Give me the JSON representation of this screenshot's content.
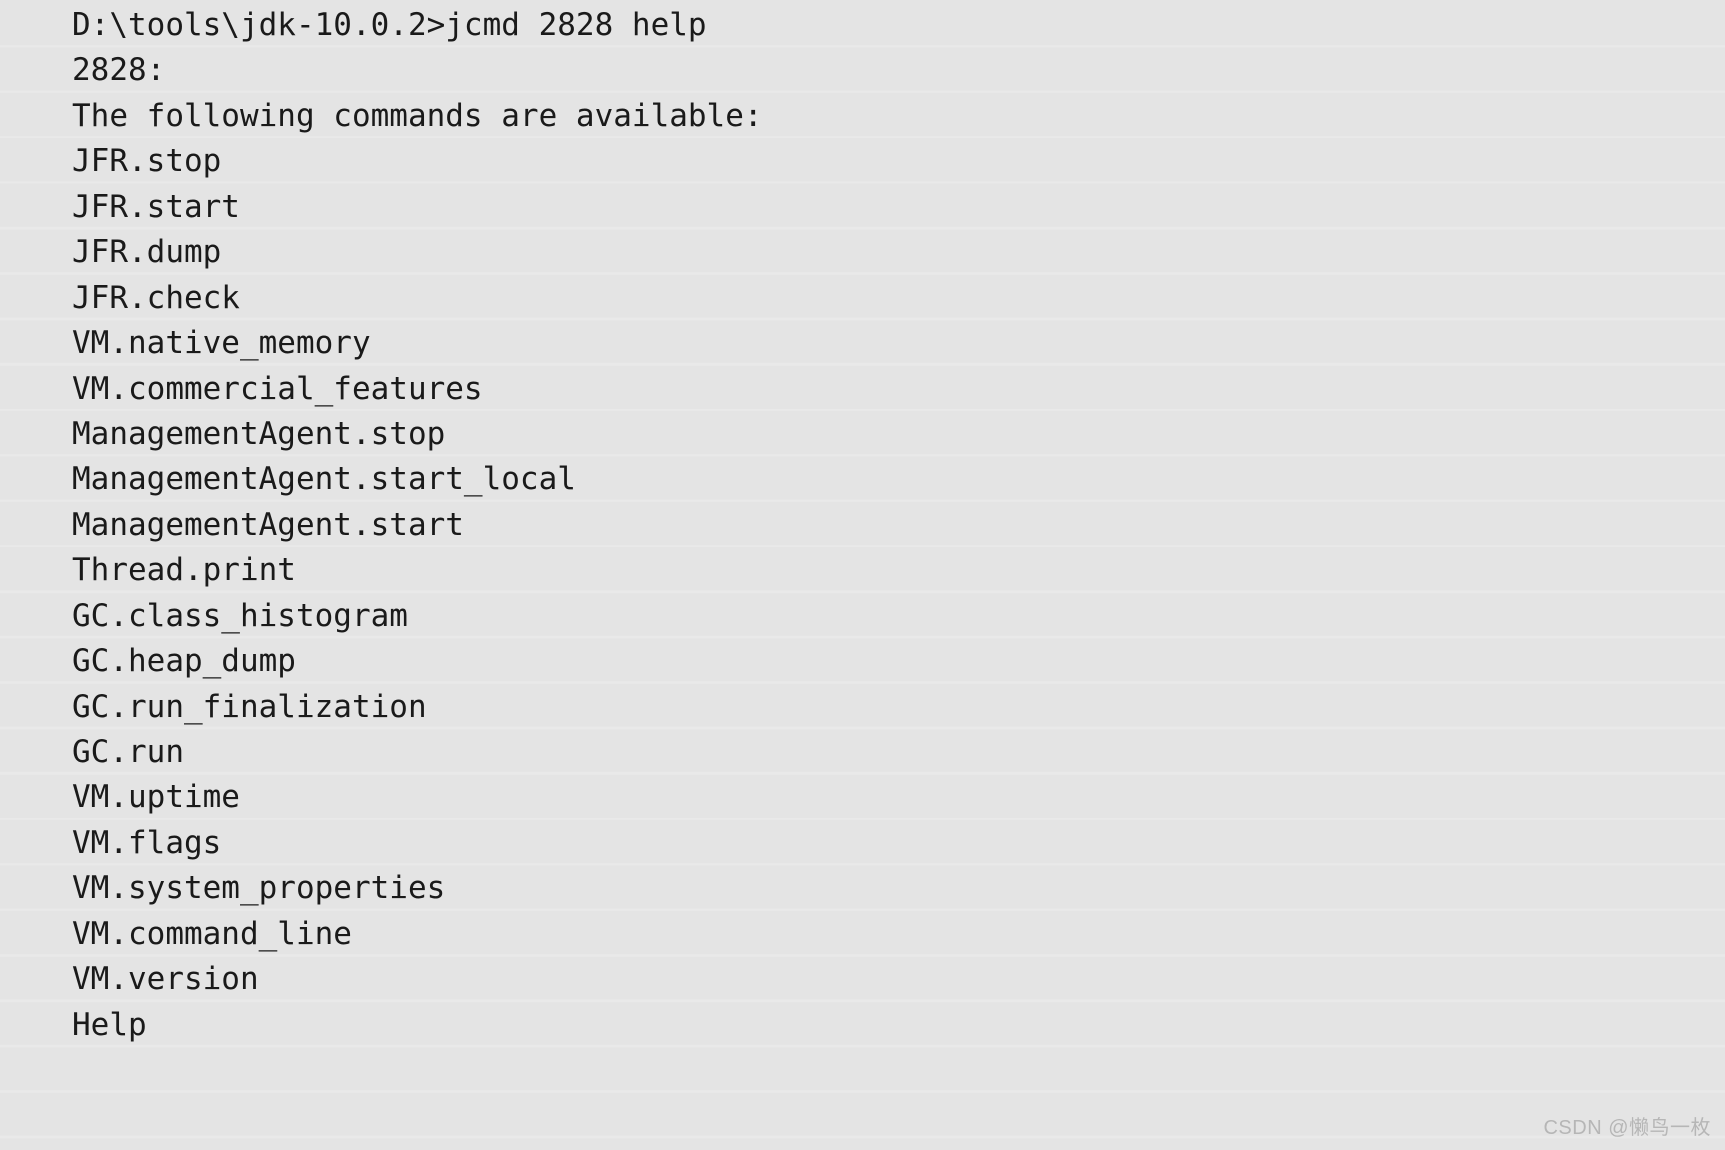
{
  "terminal": {
    "colors": {
      "background": "#e5e5e5",
      "stripe_light": "#e9e9e9",
      "stripe_dark": "#e4e4e4",
      "text": "#1a1a1a",
      "watermark": "#b6b6b6"
    },
    "prompt_line": "D:\\tools\\jdk-10.0.2>jcmd 2828 help",
    "pid_line": "2828:",
    "header_line": "The following commands are available:",
    "lines": [
      "D:\\tools\\jdk-10.0.2>jcmd 2828 help",
      "2828:",
      "The following commands are available:",
      "JFR.stop",
      "JFR.start",
      "JFR.dump",
      "JFR.check",
      "VM.native_memory",
      "VM.commercial_features",
      "ManagementAgent.stop",
      "ManagementAgent.start_local",
      "ManagementAgent.start",
      "Thread.print",
      "GC.class_histogram",
      "GC.heap_dump",
      "GC.run_finalization",
      "GC.run",
      "VM.uptime",
      "VM.flags",
      "VM.system_properties",
      "VM.command_line",
      "VM.version",
      "Help"
    ],
    "commands": [
      "JFR.stop",
      "JFR.start",
      "JFR.dump",
      "JFR.check",
      "VM.native_memory",
      "VM.commercial_features",
      "ManagementAgent.stop",
      "ManagementAgent.start_local",
      "ManagementAgent.start",
      "Thread.print",
      "GC.class_histogram",
      "GC.heap_dump",
      "GC.run_finalization",
      "GC.run",
      "VM.uptime",
      "VM.flags",
      "VM.system_properties",
      "VM.command_line",
      "VM.version",
      "Help"
    ]
  },
  "watermark": {
    "text": "CSDN @懒鸟一枚"
  }
}
